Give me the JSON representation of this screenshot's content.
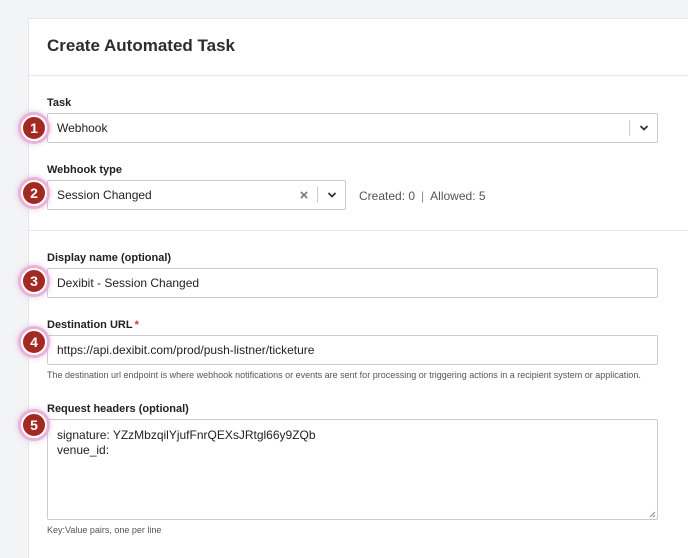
{
  "dialog": {
    "title": "Create Automated Task"
  },
  "task": {
    "label": "Task",
    "value": "Webhook",
    "badge": "1"
  },
  "webhook_type": {
    "label": "Webhook type",
    "value": "Session Changed",
    "badge": "2",
    "created": "Created: 0",
    "separator": "|",
    "allowed": "Allowed: 5"
  },
  "display_name": {
    "label": "Display name (optional)",
    "value": "Dexibit - Session Changed",
    "badge": "3"
  },
  "destination_url": {
    "label": "Destination URL",
    "required_mark": "*",
    "value": "https://api.dexibit.com/prod/push-listner/ticketure",
    "help": "The destination url endpoint is where webhook notifications or events are sent for processing or triggering actions in a recipient system or application.",
    "badge": "4"
  },
  "request_headers": {
    "label": "Request headers (optional)",
    "value": "signature: YZzMbzqilYjufFnrQEXsJRtgl66y9ZQb\nvenue_id:",
    "help": "Key:Value pairs, one per line",
    "badge": "5"
  },
  "icons": {
    "dropdown": "chevron-down-icon",
    "clear": "clear-x-icon",
    "resize": "resize-grip-icon"
  },
  "colors": {
    "badge": "#a32a22",
    "required": "#d0313b"
  }
}
